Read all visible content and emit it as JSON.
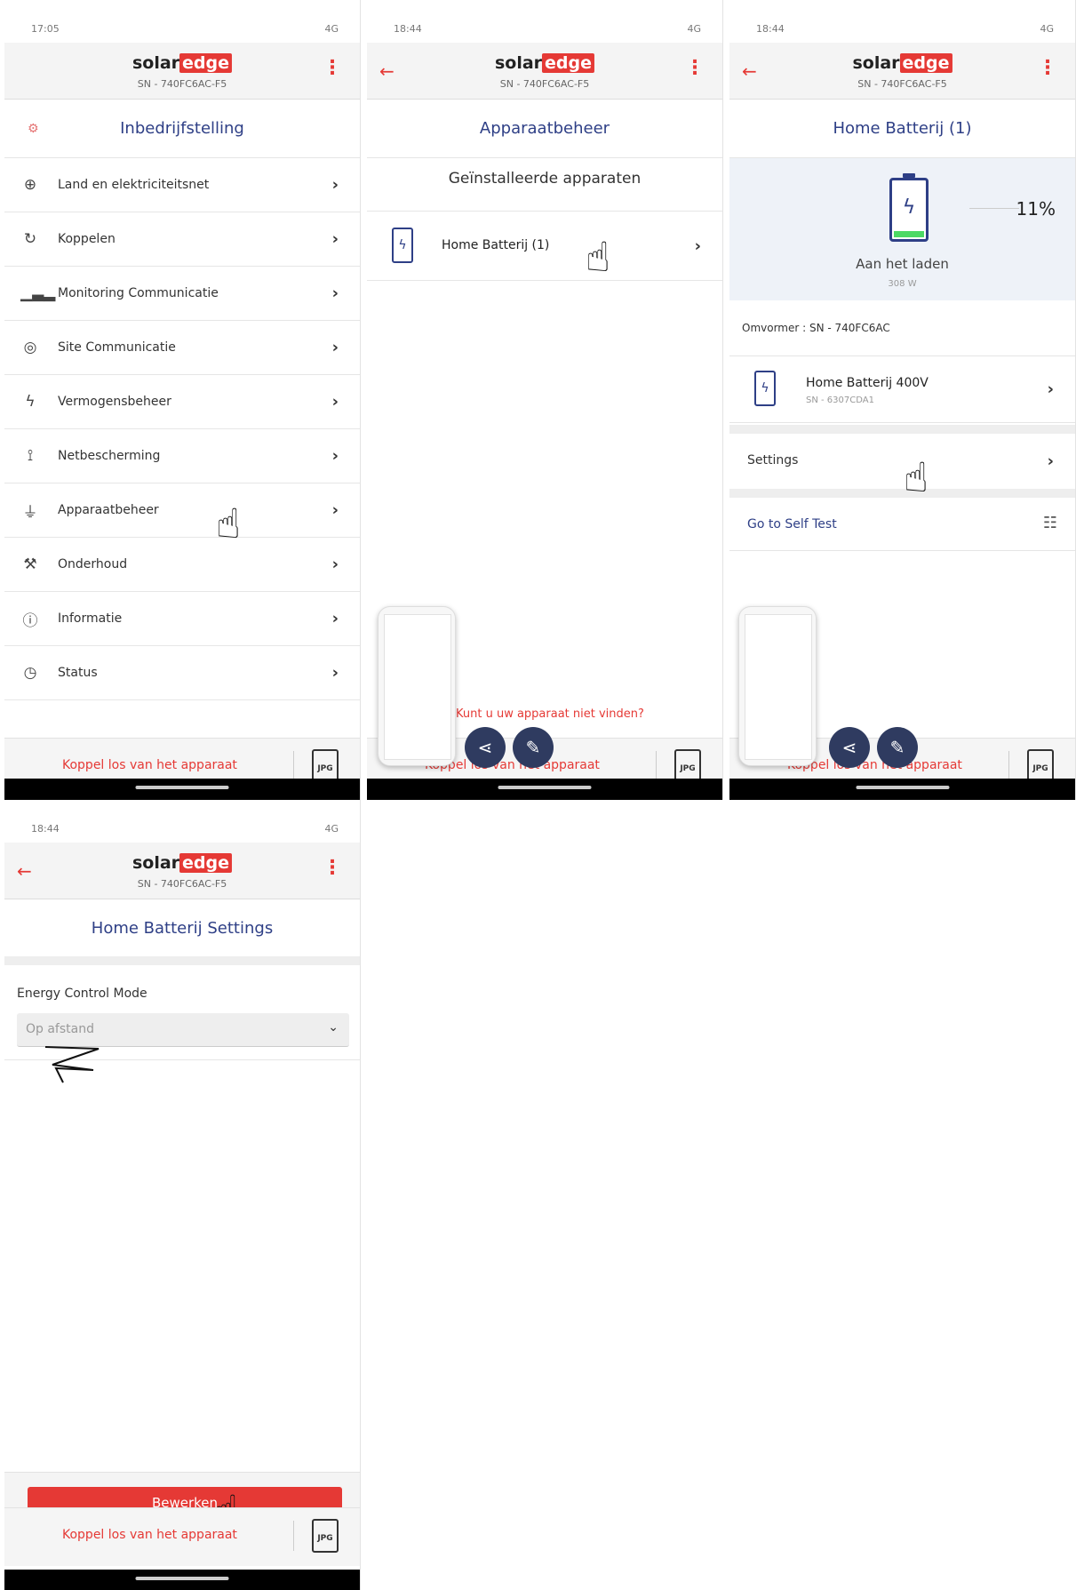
{
  "brand": {
    "solar": "solar",
    "edge": "edge",
    "accent": "#e53935",
    "title_color": "#2e3f86"
  },
  "screen1": {
    "status_time": "17:05",
    "status_right": "4G",
    "serial": "SN - 740FC6AC-F5",
    "title": "Inbedrijfstelling",
    "menu": [
      {
        "label": "Land en elektriciteitsnet",
        "icon": "globe-icon"
      },
      {
        "label": "Koppelen",
        "icon": "sync-icon"
      },
      {
        "label": "Monitoring Communicatie",
        "icon": "bar-chart-icon"
      },
      {
        "label": "Site Communicatie",
        "icon": "location-pin-icon"
      },
      {
        "label": "Vermogensbeheer",
        "icon": "lightning-icon"
      },
      {
        "label": "Netbescherming",
        "icon": "power-tower-icon"
      },
      {
        "label": "Apparaatbeheer",
        "icon": "plug-icon"
      },
      {
        "label": "Onderhoud",
        "icon": "wrench-icon"
      },
      {
        "label": "Informatie",
        "icon": "info-icon"
      },
      {
        "label": "Status",
        "icon": "gauge-icon"
      }
    ],
    "footer_link": "Koppel los van het apparaat",
    "jpg_label": "JPG"
  },
  "screen2": {
    "status_time": "18:44",
    "status_right": "4G",
    "serial": "SN - 740FC6AC-F5",
    "title": "Apparaatbeheer",
    "subheading": "Geïnstalleerde apparaten",
    "device": "Home Batterij (1)",
    "toast": "Kunt u uw apparaat niet vinden?",
    "footer_link": "Koppel los van het apparaat",
    "jpg_label": "JPG"
  },
  "screen3": {
    "status_time": "18:44",
    "status_right": "4G",
    "serial": "SN - 740FC6AC-F5",
    "title": "Home Batterij (1)",
    "charge_percent": "11%",
    "charge_fraction": 0.11,
    "state": "Aan het laden",
    "power": "308 W",
    "inverter": "Omvormer : SN - 740FC6AC",
    "battery_name": "Home Batterij 400V",
    "battery_sn": "SN - 6307CDA1",
    "settings": "Settings",
    "self_test": "Go to Self Test",
    "footer_link": "Koppel los van het apparaat",
    "jpg_label": "JPG"
  },
  "screen4": {
    "status_time": "18:44",
    "status_right": "4G",
    "serial": "SN - 740FC6AC-F5",
    "title": "Home Batterij Settings",
    "ecm_label": "Energy Control Mode",
    "ecm_value": "Op afstand",
    "edit_button": "Bewerken",
    "footer_link": "Koppel los van het apparaat",
    "jpg_label": "JPG"
  }
}
